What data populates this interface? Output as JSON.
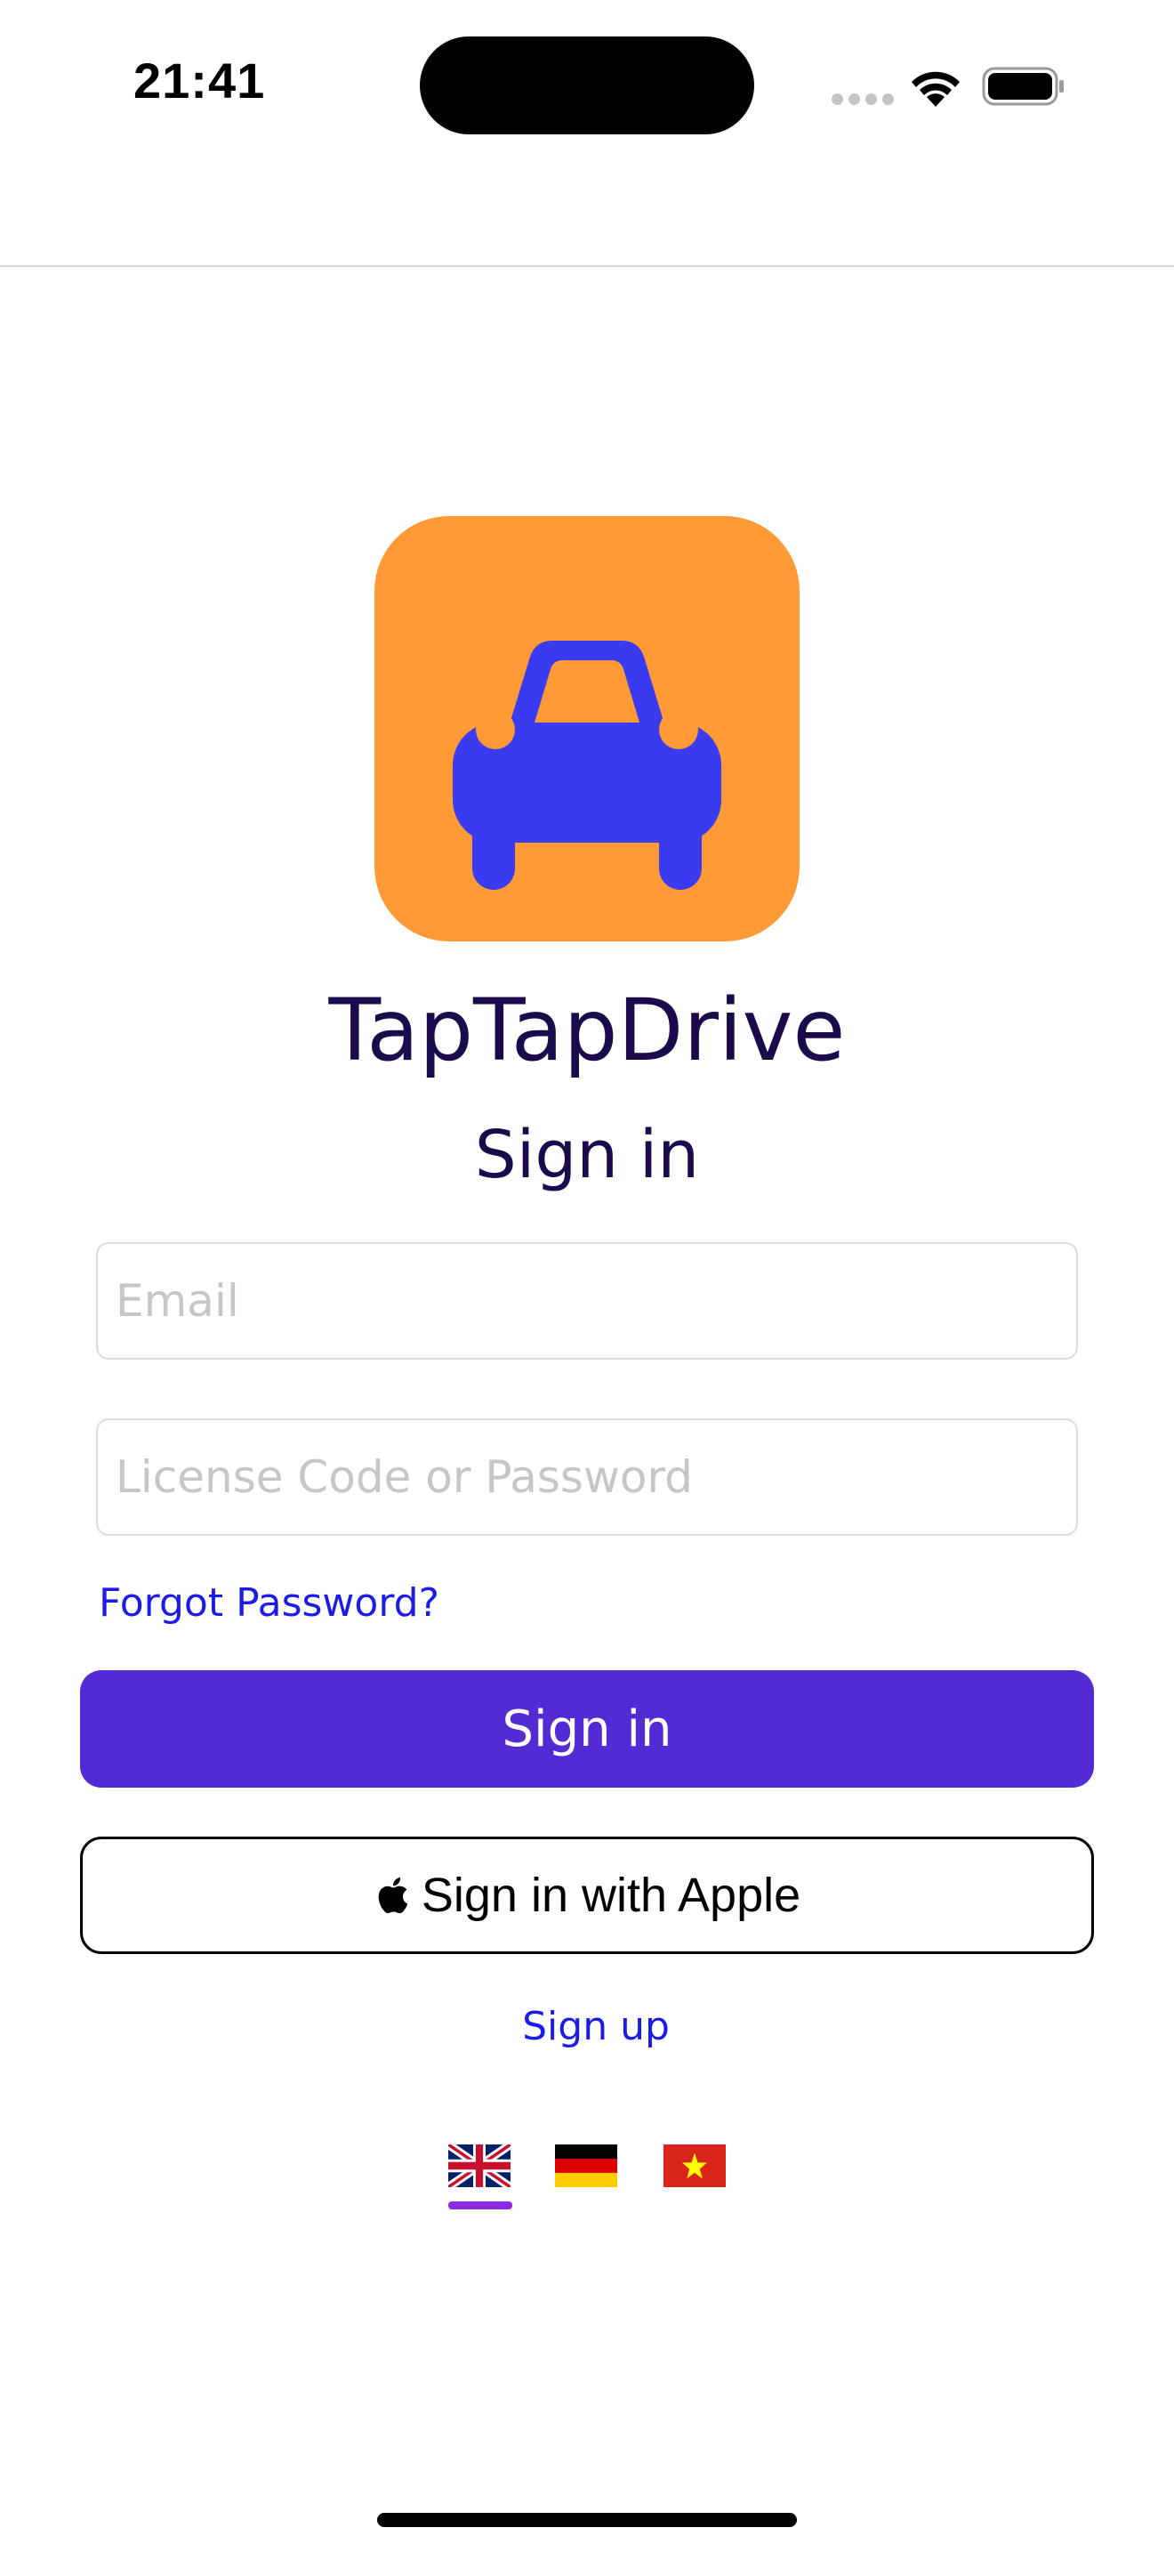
{
  "status_bar": {
    "time": "21:41"
  },
  "app": {
    "name": "TapTapDrive",
    "icon": "car-icon",
    "icon_background": "#ff9a37",
    "icon_color": "#3a3af0"
  },
  "form": {
    "title": "Sign in",
    "email_placeholder": "Email",
    "email_value": "",
    "password_placeholder": "License Code or Password",
    "password_value": "",
    "forgot_password_label": "Forgot Password?",
    "sign_in_button_label": "Sign in",
    "apple_button_label": "Sign in with Apple",
    "sign_up_label": "Sign up"
  },
  "languages": [
    {
      "code": "en",
      "icon": "uk-flag-icon",
      "selected": true
    },
    {
      "code": "de",
      "icon": "germany-flag-icon",
      "selected": false
    },
    {
      "code": "vi",
      "icon": "vietnam-flag-icon",
      "selected": false
    }
  ],
  "colors": {
    "primary": "#522bd4",
    "link": "#1c1ce8",
    "title_text": "#1a0b4d",
    "selected_language_indicator": "#8a2be2"
  }
}
